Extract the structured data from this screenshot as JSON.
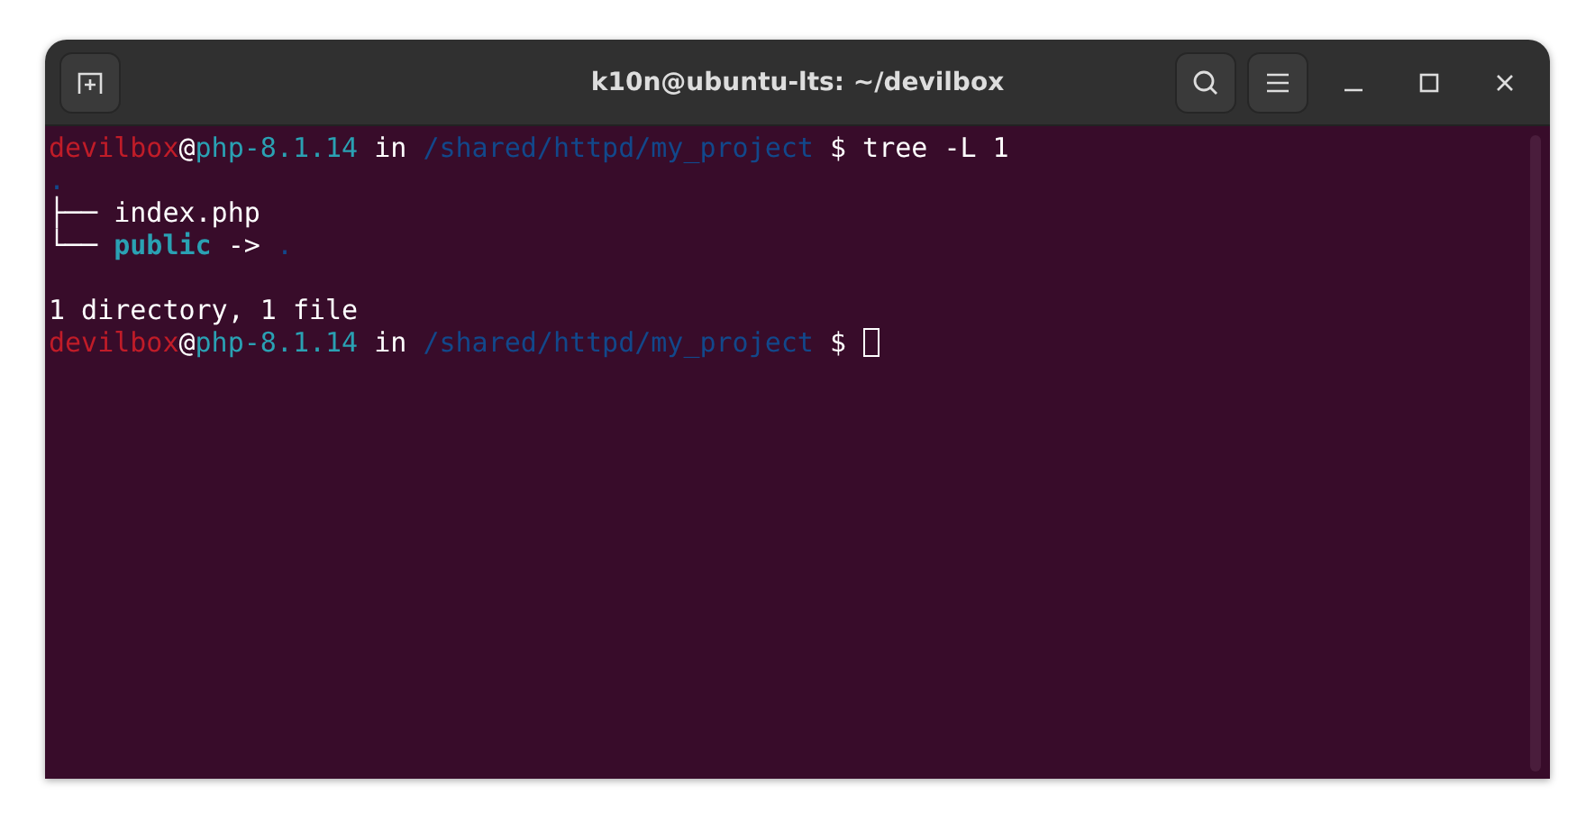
{
  "window": {
    "title": "k10n@ubuntu-lts: ~/devilbox"
  },
  "terminal": {
    "lines": [
      {
        "kind": "text",
        "cursor": false,
        "segments": [
          {
            "kind": "user",
            "text": "devilbox"
          },
          {
            "kind": "plain",
            "text": "@"
          },
          {
            "kind": "host",
            "text": "php-8.1.14"
          },
          {
            "kind": "plain",
            "text": " in "
          },
          {
            "kind": "path",
            "text": "/shared/httpd/my_project"
          },
          {
            "kind": "plain",
            "text": " $ tree -L 1"
          }
        ]
      },
      {
        "kind": "text",
        "cursor": false,
        "segments": [
          {
            "kind": "path",
            "text": "."
          }
        ]
      },
      {
        "kind": "text",
        "cursor": false,
        "segments": [
          {
            "kind": "plain",
            "text": "├── index.php"
          }
        ]
      },
      {
        "kind": "text",
        "cursor": false,
        "segments": [
          {
            "kind": "plain",
            "text": "└── "
          },
          {
            "kind": "dir",
            "text": "public"
          },
          {
            "kind": "plain",
            "text": " -> "
          },
          {
            "kind": "path",
            "text": "."
          }
        ]
      },
      {
        "kind": "blank"
      },
      {
        "kind": "text",
        "cursor": false,
        "segments": [
          {
            "kind": "plain",
            "text": "1 directory, 1 file"
          }
        ]
      },
      {
        "kind": "text",
        "cursor": true,
        "segments": [
          {
            "kind": "user",
            "text": "devilbox"
          },
          {
            "kind": "plain",
            "text": "@"
          },
          {
            "kind": "host",
            "text": "php-8.1.14"
          },
          {
            "kind": "plain",
            "text": " in "
          },
          {
            "kind": "path",
            "text": "/shared/httpd/my_project"
          },
          {
            "kind": "plain",
            "text": " $ "
          }
        ]
      }
    ]
  }
}
